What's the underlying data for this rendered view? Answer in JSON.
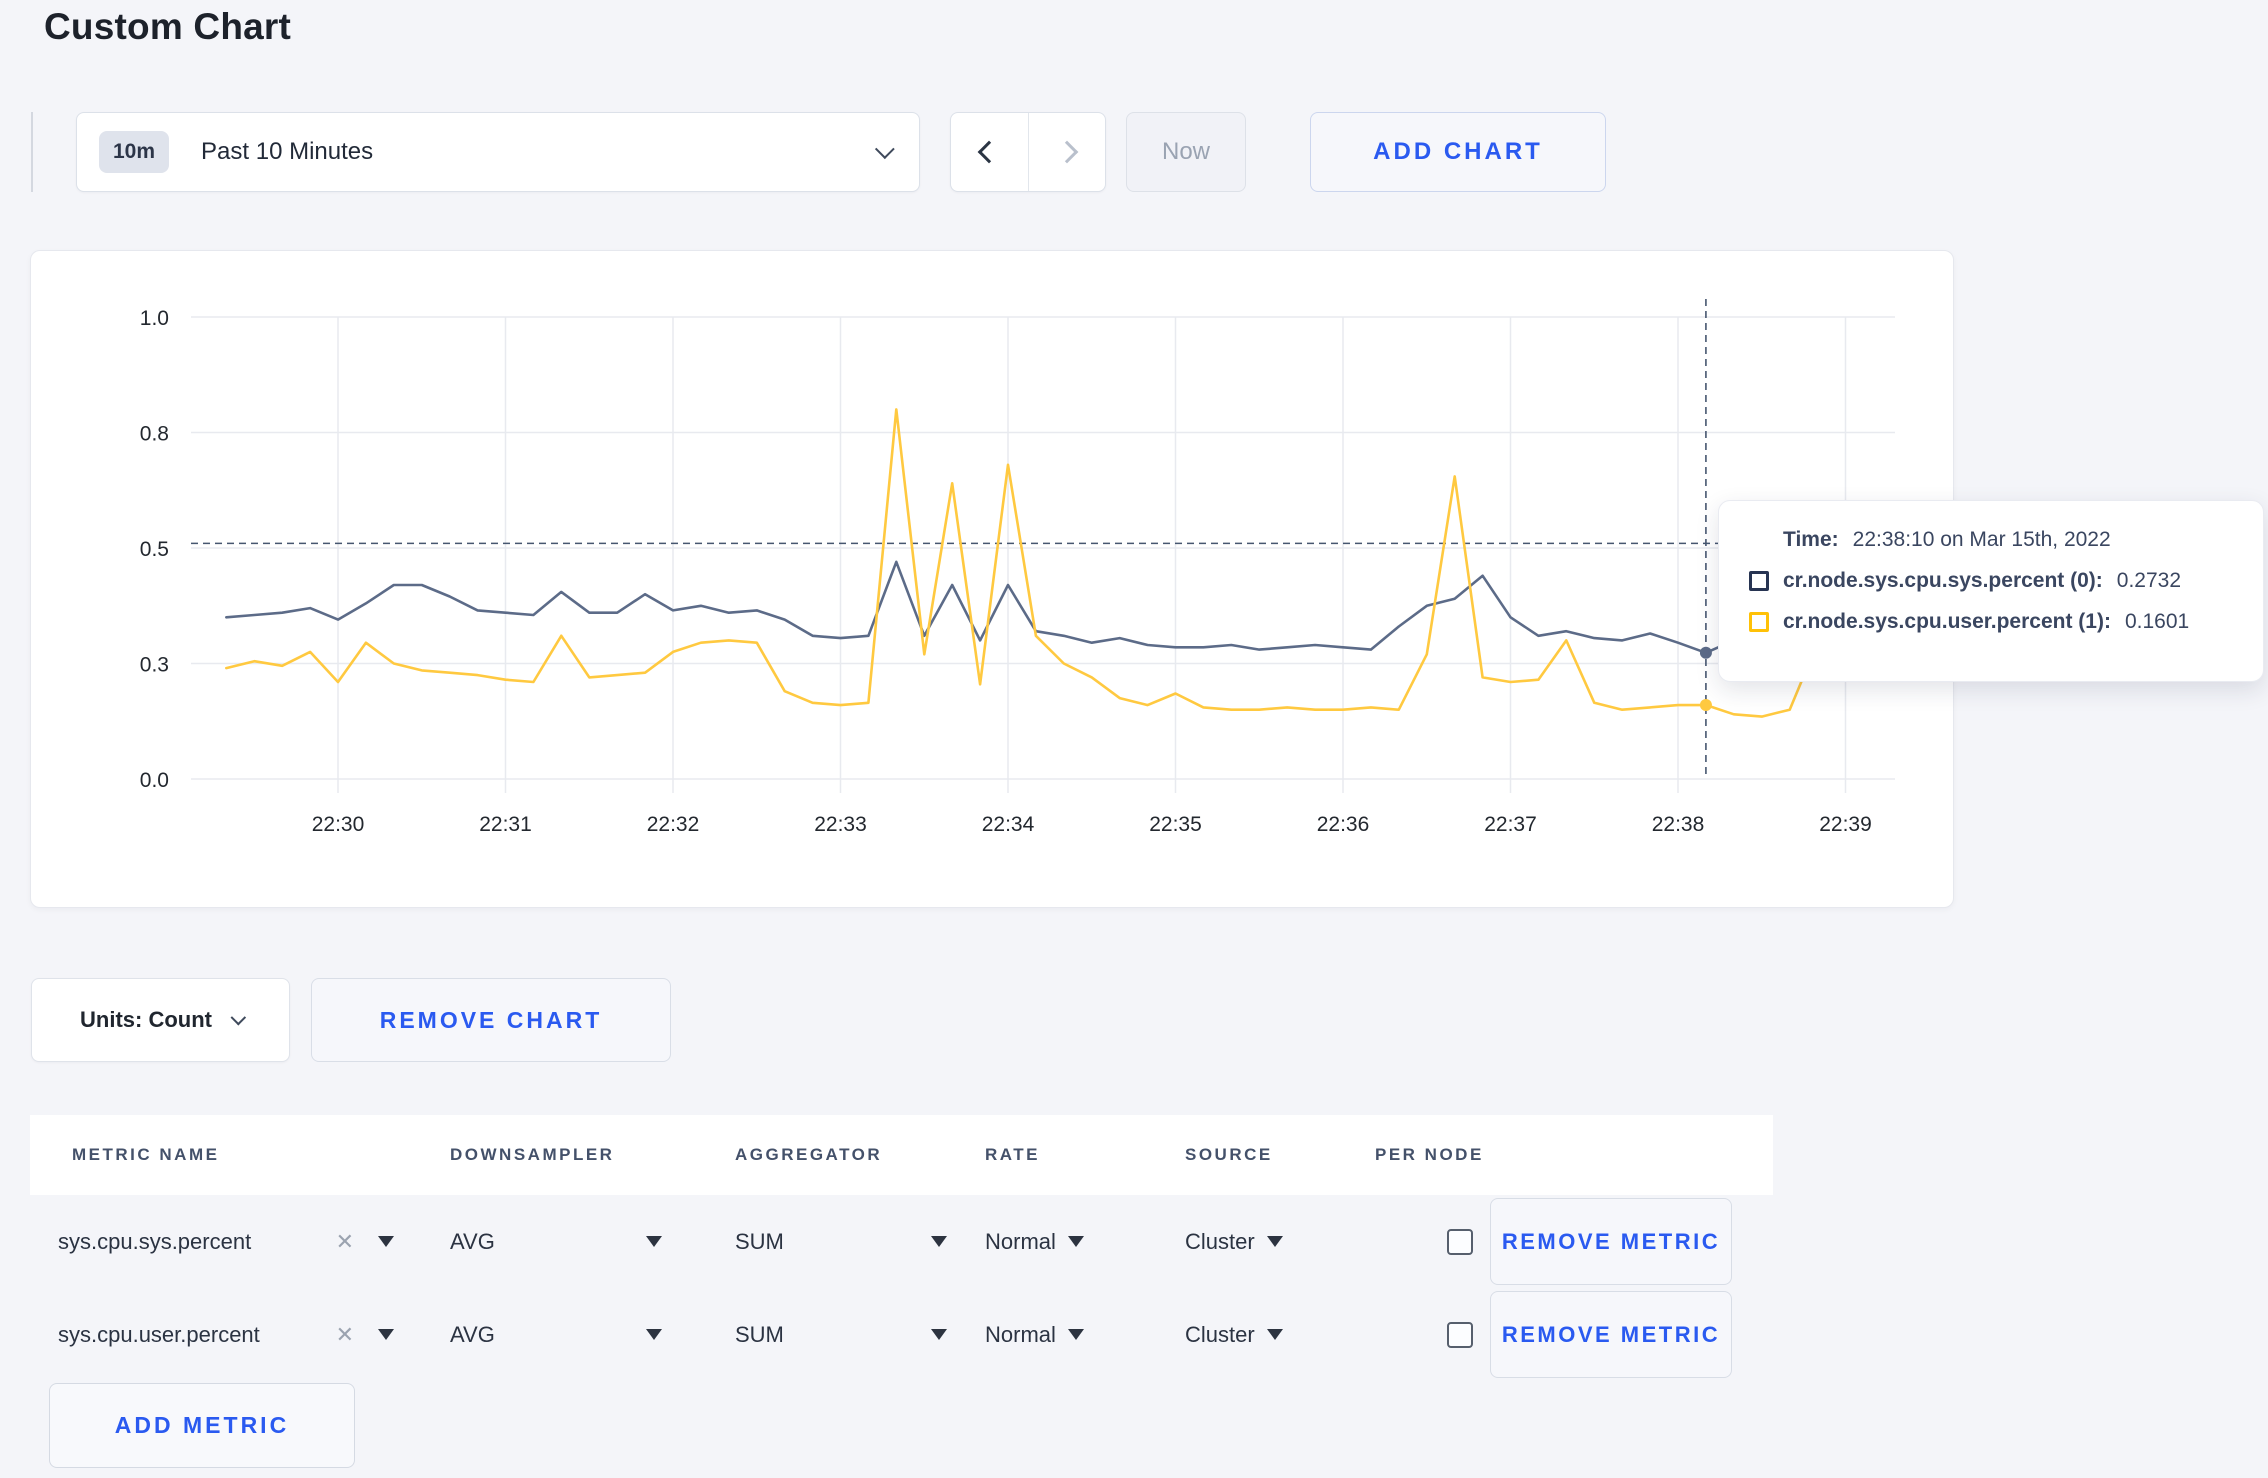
{
  "page": {
    "title": "Custom Chart"
  },
  "toolbar": {
    "range_badge": "10m",
    "range_label": "Past 10 Minutes",
    "now_label": "Now",
    "add_chart_label": "ADD CHART"
  },
  "chart_data": {
    "type": "line",
    "x_ticks": [
      "22:30",
      "22:31",
      "22:32",
      "22:33",
      "22:34",
      "22:35",
      "22:36",
      "22:37",
      "22:38",
      "22:39"
    ],
    "y_ticks": [
      {
        "v": 0,
        "label": "0.0"
      },
      {
        "v": 0.25,
        "label": "0.3"
      },
      {
        "v": 0.5,
        "label": "0.5"
      },
      {
        "v": 0.75,
        "label": "0.8"
      },
      {
        "v": 1.0,
        "label": "1.0"
      }
    ],
    "ylim": [
      0,
      1
    ],
    "grid": true,
    "x_start_offset_s": -40,
    "x_step_s": 10,
    "series": [
      {
        "name": "cr.node.sys.cpu.sys.percent (0)",
        "color": "#5c6b88",
        "values": [
          0.35,
          0.355,
          0.36,
          0.37,
          0.345,
          0.38,
          0.42,
          0.42,
          0.395,
          0.365,
          0.36,
          0.355,
          0.405,
          0.36,
          0.36,
          0.4,
          0.365,
          0.375,
          0.36,
          0.365,
          0.345,
          0.31,
          0.305,
          0.31,
          0.47,
          0.31,
          0.42,
          0.3,
          0.42,
          0.32,
          0.31,
          0.295,
          0.305,
          0.29,
          0.285,
          0.285,
          0.29,
          0.28,
          0.285,
          0.29,
          0.285,
          0.28,
          0.33,
          0.375,
          0.39,
          0.44,
          0.35,
          0.31,
          0.32,
          0.305,
          0.3,
          0.315,
          0.295,
          0.2732,
          0.3,
          0.295,
          0.31,
          0.3,
          0.3,
          0.31
        ]
      },
      {
        "name": "cr.node.sys.cpu.user.percent (1)",
        "color": "#ffc940",
        "values": [
          0.24,
          0.255,
          0.245,
          0.275,
          0.21,
          0.295,
          0.25,
          0.235,
          0.23,
          0.225,
          0.215,
          0.21,
          0.31,
          0.22,
          0.225,
          0.23,
          0.275,
          0.295,
          0.3,
          0.295,
          0.19,
          0.165,
          0.16,
          0.165,
          0.8,
          0.27,
          0.64,
          0.205,
          0.68,
          0.31,
          0.25,
          0.22,
          0.175,
          0.16,
          0.185,
          0.155,
          0.15,
          0.15,
          0.155,
          0.15,
          0.15,
          0.155,
          0.15,
          0.27,
          0.655,
          0.22,
          0.21,
          0.215,
          0.3,
          0.165,
          0.15,
          0.155,
          0.16,
          0.1601,
          0.14,
          0.135,
          0.15,
          0.295,
          0.245,
          0.27
        ]
      }
    ],
    "crosshair": {
      "point_index": 53,
      "y_value": 0.51
    },
    "tooltip": {
      "time_label": "Time:",
      "time_value": "22:38:10 on Mar 15th, 2022",
      "entries": [
        {
          "label": "cr.node.sys.cpu.sys.percent (0):",
          "value": "0.2732",
          "swatch_color": "#273452"
        },
        {
          "label": "cr.node.sys.cpu.user.percent (1):",
          "value": "0.1601",
          "swatch_color": "#ffc107"
        }
      ]
    }
  },
  "chart_footer": {
    "units_label": "Units: Count",
    "remove_chart_label": "REMOVE CHART"
  },
  "metrics_table": {
    "headers": [
      "METRIC NAME",
      "DOWNSAMPLER",
      "AGGREGATOR",
      "RATE",
      "SOURCE",
      "PER NODE"
    ],
    "rows": [
      {
        "metric": "sys.cpu.sys.percent",
        "downsampler": "AVG",
        "aggregator": "SUM",
        "rate": "Normal",
        "source": "Cluster",
        "per_node_checked": false,
        "remove_label": "REMOVE METRIC"
      },
      {
        "metric": "sys.cpu.user.percent",
        "downsampler": "AVG",
        "aggregator": "SUM",
        "rate": "Normal",
        "source": "Cluster",
        "per_node_checked": false,
        "remove_label": "REMOVE METRIC"
      }
    ],
    "remove_x": "✕",
    "add_metric_label": "ADD METRIC"
  }
}
